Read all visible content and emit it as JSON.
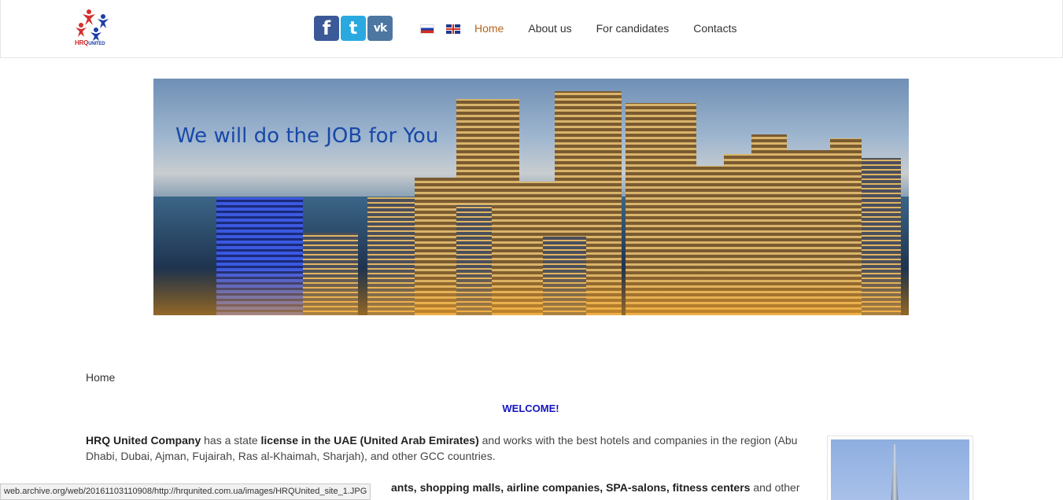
{
  "header": {
    "logo": {
      "text_main": "HRQ",
      "text_sub": "UNITED"
    },
    "social": {
      "facebook": "f",
      "twitter": "t",
      "vk": "vk"
    },
    "nav": [
      {
        "label": "Home",
        "active": true
      },
      {
        "label": "About us"
      },
      {
        "label": "For candidates"
      },
      {
        "label": "Contacts"
      }
    ]
  },
  "banner": {
    "tagline": "We will do the JOB for You"
  },
  "breadcrumb": "Home",
  "welcome": "WELCOME!",
  "para1": {
    "b1": "HRQ United Company",
    "t1": " has a state ",
    "b2": "license in the UAE (United Arab Emirates)",
    "t2": " and works with the best hotels and companies in the region (Abu Dhabi, Dubai, Ajman, Fujairah, Ras al-Khaimah, Sharjah), and other GCC countries."
  },
  "para2": {
    "b1": "ants, shopping malls, airline companies, SPA-salons, fitness centers",
    "t1": " and other"
  },
  "status_url": "web.archive.org/web/20161103110908/http://hrqunited.com.ua/images/HRQUnited_site_1.JPG",
  "colors": {
    "nav_active": "#b5651d",
    "welcome": "#1515c0"
  }
}
